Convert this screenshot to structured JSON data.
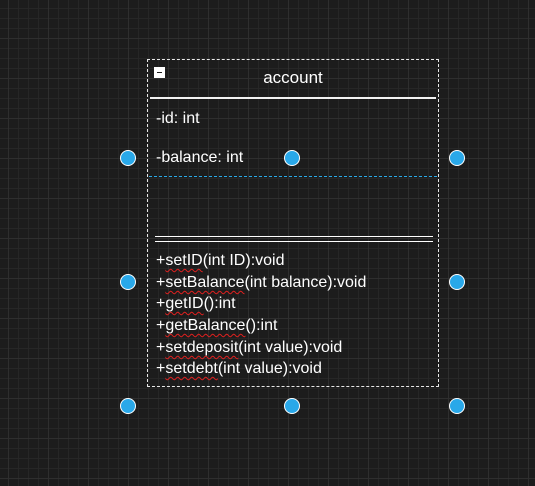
{
  "class_box": {
    "name": "account",
    "attributes": [
      {
        "text": "-id: int"
      },
      {
        "text": "-balance: int"
      }
    ],
    "methods": [
      {
        "prefix": "+",
        "word": "setID",
        "rest": "(int ID):void"
      },
      {
        "prefix": "+",
        "word": "setBalance",
        "rest": "(int balance):void"
      },
      {
        "prefix": "+",
        "word": "getID",
        "rest": "():int"
      },
      {
        "prefix": "+",
        "word": "getBalance",
        "rest": "():int"
      },
      {
        "prefix": "+",
        "word": "setdeposit",
        "rest": "(int value):void"
      },
      {
        "prefix": "+",
        "word": "setdebt",
        "rest": "(int value):void"
      }
    ]
  },
  "colors": {
    "canvas_background": "#1c1c1c",
    "grid_major": "#2e2e2e",
    "grid_minor": "#262626",
    "selection_handle": "#29a8e9",
    "spellcheck_underline": "#e0201f",
    "text": "#ffffff"
  },
  "icons": {
    "collapse": "minus-square-icon",
    "resize_handle": "circle-handle"
  }
}
